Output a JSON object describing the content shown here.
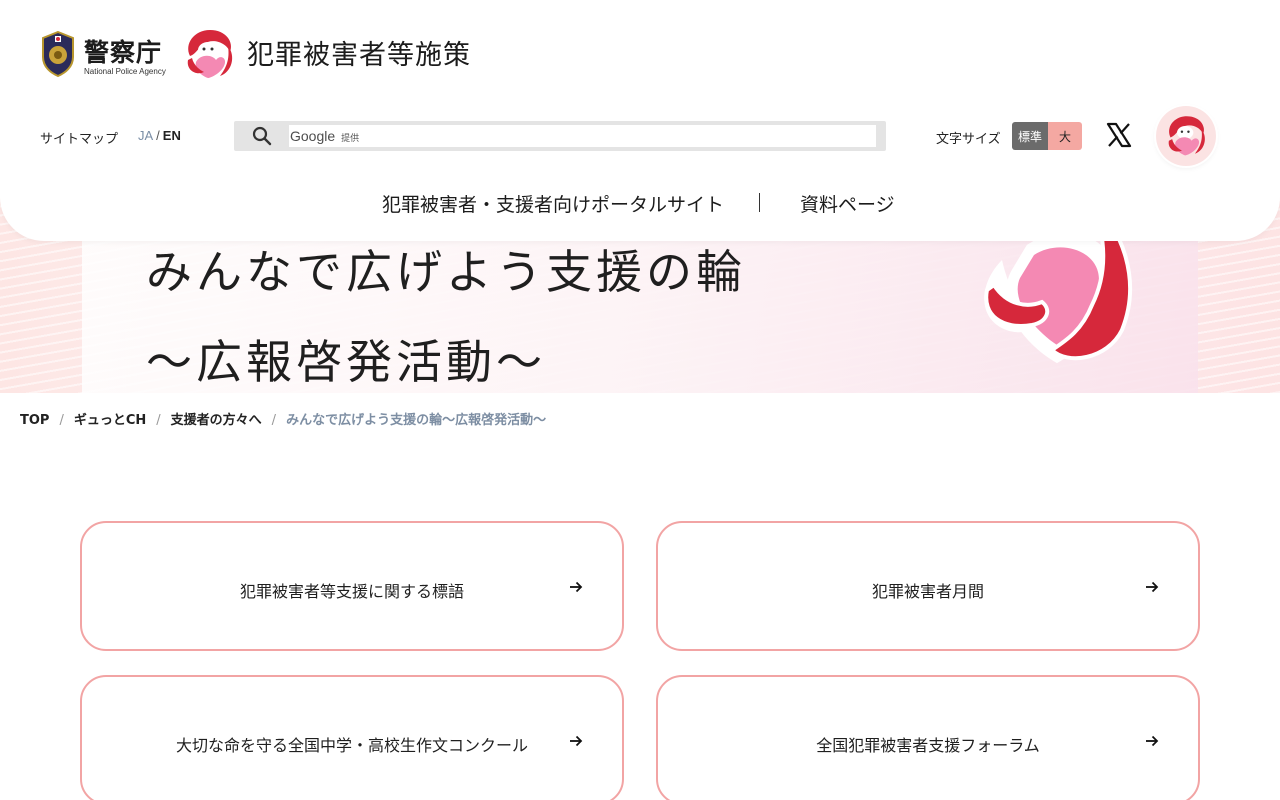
{
  "header": {
    "agency_name": "警察庁",
    "agency_name_en": "National Police Agency",
    "site_title": "犯罪被害者等施策",
    "sitemap_label": "サイトマップ",
    "lang_ja": "JA",
    "lang_sep": "/",
    "lang_en": "EN",
    "search": {
      "brand": "Google",
      "brand_suffix": "提供",
      "value": ""
    },
    "font_size_label": "文字サイズ",
    "font_size_standard": "標準",
    "font_size_large": "大",
    "nav": [
      {
        "label": "犯罪被害者・支援者向けポータルサイト"
      },
      {
        "label": "資料ページ"
      }
    ]
  },
  "hero": {
    "title_line1": "みんなで広げよう支援の輪",
    "title_line2": "～広報啓発活動～"
  },
  "breadcrumb": {
    "items": [
      "TOP",
      "ギュっとCH",
      "支援者の方々へ"
    ],
    "separator": "/",
    "current": "みんなで広げよう支援の輪～広報啓発活動～"
  },
  "cards": [
    {
      "label": "犯罪被害者等支援に関する標語"
    },
    {
      "label": "犯罪被害者月間"
    },
    {
      "label": "大切な命を守る全国中学・高校生作文コンクール"
    },
    {
      "label": "全国犯罪被害者支援フォーラム"
    }
  ],
  "colors": {
    "accent_pink": "#f2a4a4",
    "mascot_red": "#d6283b",
    "mascot_pink": "#f27fa6",
    "breadcrumb_current": "#7d8ea3"
  },
  "icons": {
    "search": "search-icon",
    "x_logo": "x-logo-icon",
    "arrow": "arrow-right-icon",
    "mascot": "mascot-icon",
    "badge": "police-badge-icon"
  }
}
